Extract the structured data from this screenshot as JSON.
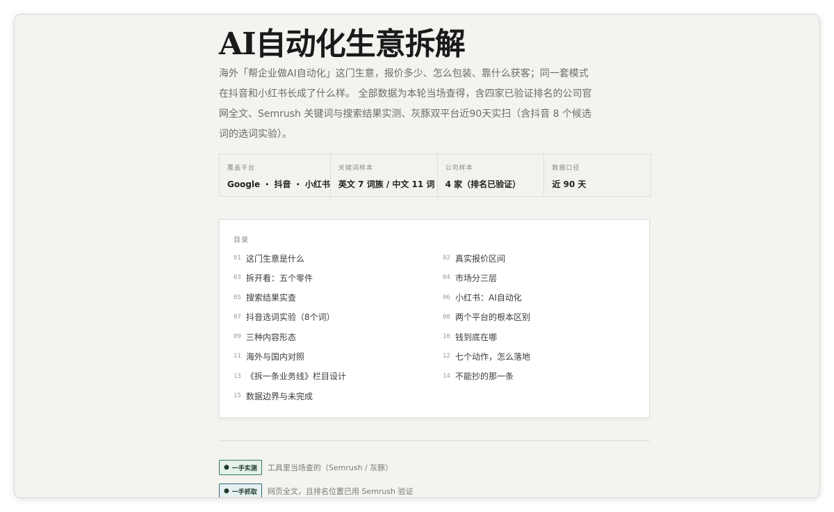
{
  "title": "AI自动化生意拆解",
  "lede": "海外「帮企业做AI自动化」这门生意，报价多少、怎么包装、靠什么获客；同一套模式在抖音和小红书长成了什么样。 全部数据为本轮当场查得，含四家已验证排名的公司官网全文、Semrush 关键词与搜索结果实测、灰豚双平台近90天实扫（含抖音 8 个候选词的选词实验）。",
  "stats": [
    {
      "label": "覆盖平台",
      "value": "Google ・ 抖音 ・ 小红书"
    },
    {
      "label": "关键词样本",
      "value": "英文 7 词族 / 中文 11 词"
    },
    {
      "label": "公司样本",
      "value": "4 家（排名已验证）"
    },
    {
      "label": "数据口径",
      "value": "近 90 天"
    }
  ],
  "toc": {
    "title": "目录",
    "items": [
      {
        "num": "01",
        "text": "这门生意是什么"
      },
      {
        "num": "02",
        "text": "真实报价区间"
      },
      {
        "num": "03",
        "text": "拆开看：五个零件"
      },
      {
        "num": "04",
        "text": "市场分三层"
      },
      {
        "num": "05",
        "text": "搜索结果实查"
      },
      {
        "num": "06",
        "text": "小红书：AI自动化"
      },
      {
        "num": "07",
        "text": "抖音选词实验（8个词）"
      },
      {
        "num": "08",
        "text": "两个平台的根本区别"
      },
      {
        "num": "09",
        "text": "三种内容形态"
      },
      {
        "num": "10",
        "text": "钱到底在哪"
      },
      {
        "num": "11",
        "text": "海外与国内对照"
      },
      {
        "num": "12",
        "text": "七个动作，怎么落地"
      },
      {
        "num": "13",
        "text": "《拆一条业务线》栏目设计"
      },
      {
        "num": "14",
        "text": "不能抄的那一条"
      },
      {
        "num": "15",
        "text": "数据边界与未完成"
      }
    ]
  },
  "legend": [
    {
      "badge": "一手实测",
      "text": "工具里当场查的（Semrush / 灰豚）",
      "color": "#2f7a4f",
      "bg": "#e6f1ea"
    },
    {
      "badge": "一手抓取",
      "text": "网页全文，且排名位置已用 Semrush 验证",
      "color": "#2f6c7a",
      "bg": "#e6eff1"
    }
  ]
}
